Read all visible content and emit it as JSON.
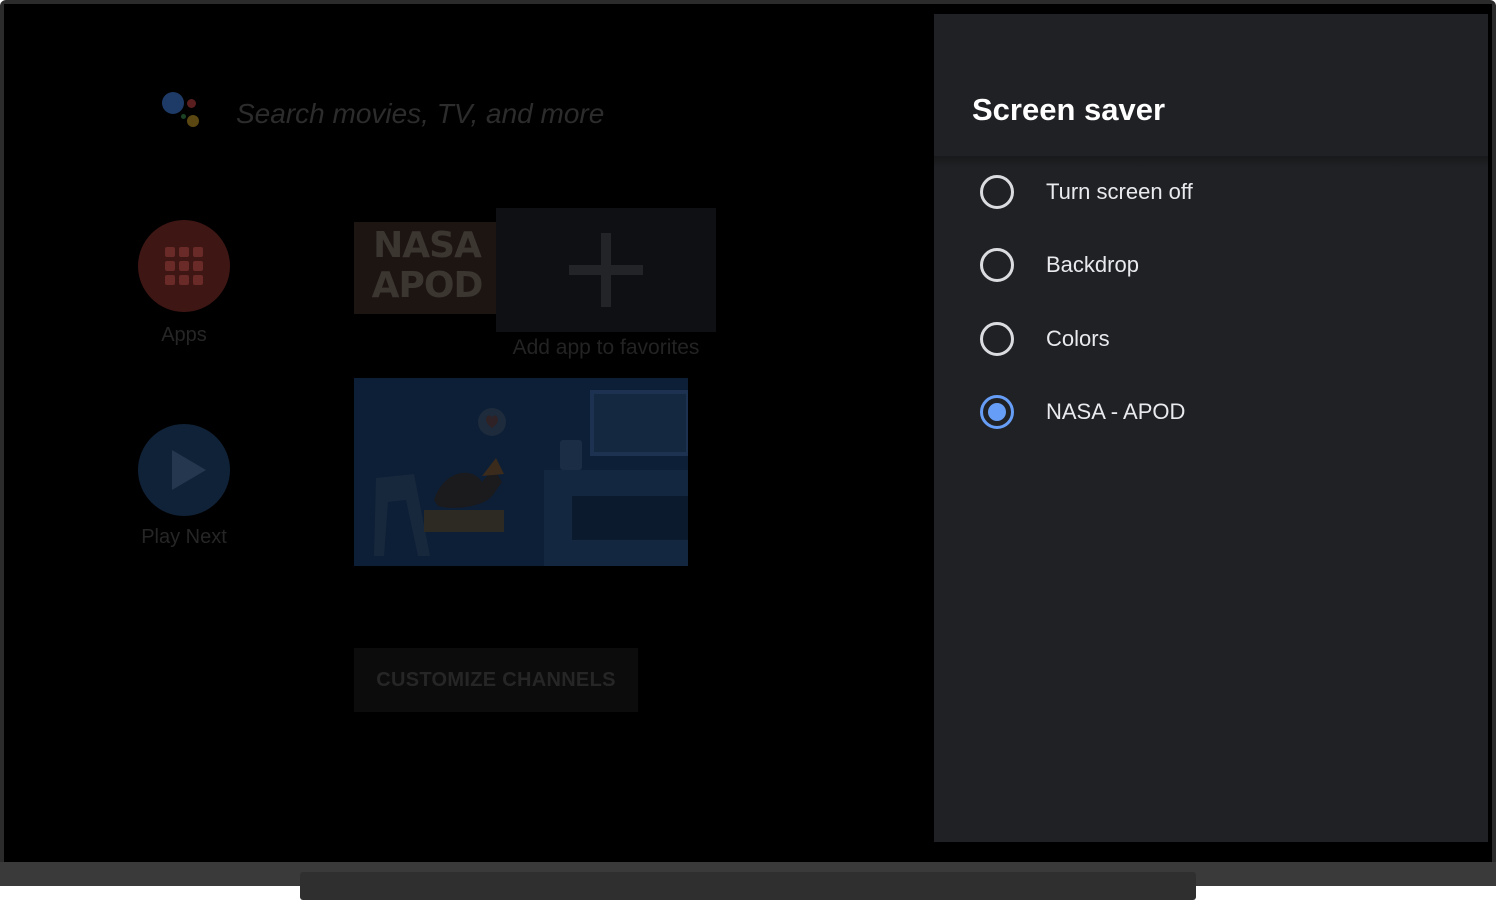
{
  "home": {
    "search_placeholder": "Search movies, TV, and more",
    "apps_label": "Apps",
    "play_next_label": "Play Next",
    "nasa_tile_text": "NASA APOD",
    "add_favorites_label": "Add app to favorites",
    "customize_button": "CUSTOMIZE CHANNELS"
  },
  "panel": {
    "title": "Screen saver",
    "options": [
      {
        "label": "Turn screen off",
        "selected": false
      },
      {
        "label": "Backdrop",
        "selected": false
      },
      {
        "label": "Colors",
        "selected": false
      },
      {
        "label": "NASA - APOD",
        "selected": true
      }
    ],
    "accent_color": "#669df6"
  },
  "icons": {
    "assistant": "google-assistant-icon",
    "apps": "apps-grid-icon",
    "play_next": "play-icon",
    "add": "plus-icon"
  }
}
